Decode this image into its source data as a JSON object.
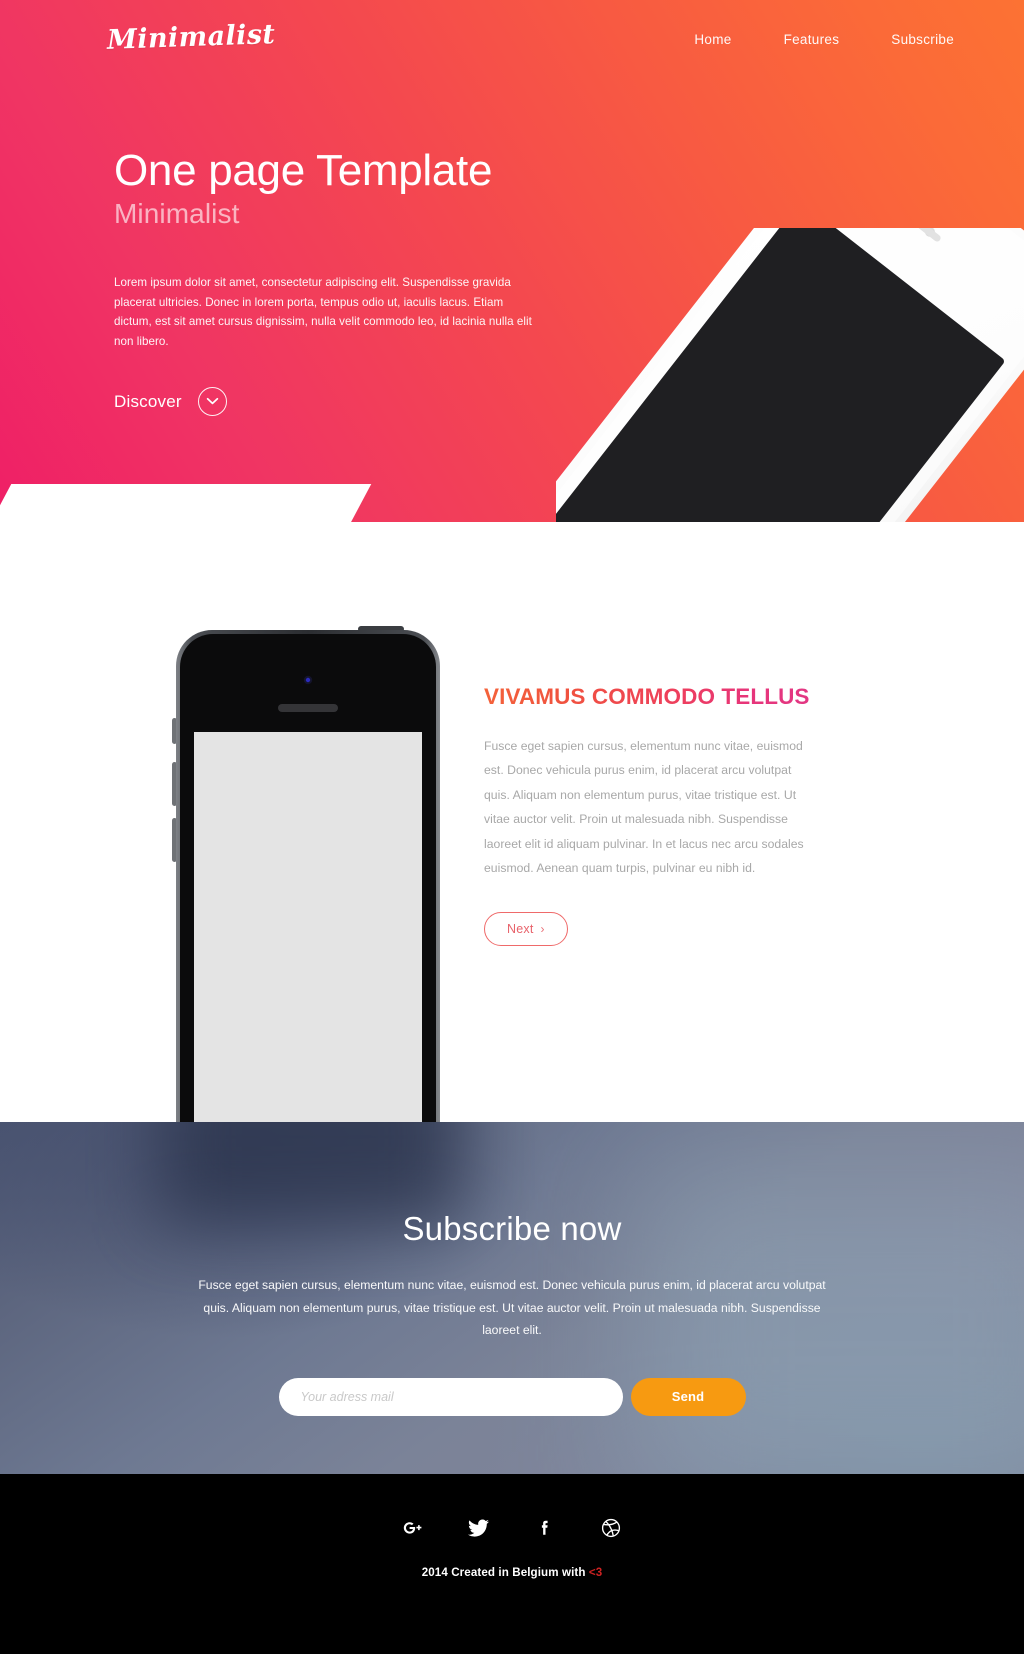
{
  "brand": {
    "logo": "Minimalist"
  },
  "nav": {
    "items": [
      {
        "label": "Home"
      },
      {
        "label": "Features"
      },
      {
        "label": "Subscribe"
      }
    ]
  },
  "hero": {
    "title": "One page Template",
    "subtitle": "Minimalist",
    "paragraph": "Lorem ipsum dolor sit amet, consectetur adipiscing elit. Suspendisse gravida placerat ultricies. Donec in lorem porta, tempus odio ut, iaculis lacus. Etiam dictum, est sit amet cursus dignissim, nulla velit commodo leo, id lacinia nulla elit non libero.",
    "discover_label": "Discover",
    "discover_icon": "chevron-down-icon",
    "gradient_start": "#ef1f66",
    "gradient_end": "#fc7233",
    "device_image": "white-iphone-tilted"
  },
  "features": {
    "heading": "VIVAMUS COMMODO TELLUS",
    "paragraph": "Fusce eget sapien cursus, elementum nunc vitae, euismod est. Donec vehicula purus enim, id placerat arcu volutpat quis. Aliquam non elementum purus, vitae tristique est. Ut vitae auctor velit. Proin ut malesuada nibh. Suspendisse laoreet elit id aliquam pulvinar. In et lacus nec arcu sodales euismod. Aenean quam turpis, pulvinar eu nibh id.",
    "next_label": "Next",
    "next_chevron": "›",
    "heading_color_start": "#f4623a",
    "heading_color_end": "#e23784",
    "device_image": "black-iphone-front"
  },
  "subscribe": {
    "title": "Subscribe now",
    "paragraph": "Fusce eget sapien cursus, elementum nunc vitae, euismod est. Donec vehicula purus enim, id placerat arcu volutpat quis. Aliquam non elementum purus, vitae tristique est. Ut vitae auctor velit. Proin ut malesuada nibh. Suspendisse laoreet elit.",
    "email_placeholder": "Your adress mail",
    "email_value": "",
    "send_label": "Send",
    "send_color": "#f79a11"
  },
  "footer": {
    "social": [
      {
        "name": "google-plus-icon",
        "label": "Google Plus"
      },
      {
        "name": "twitter-icon",
        "label": "Twitter"
      },
      {
        "name": "facebook-icon",
        "label": "Facebook"
      },
      {
        "name": "dribbble-icon",
        "label": "Dribbble"
      }
    ],
    "copyright_text": "2014 Created in Belgium with ",
    "copyright_heart": "<3",
    "heart_color": "#cc2222"
  }
}
